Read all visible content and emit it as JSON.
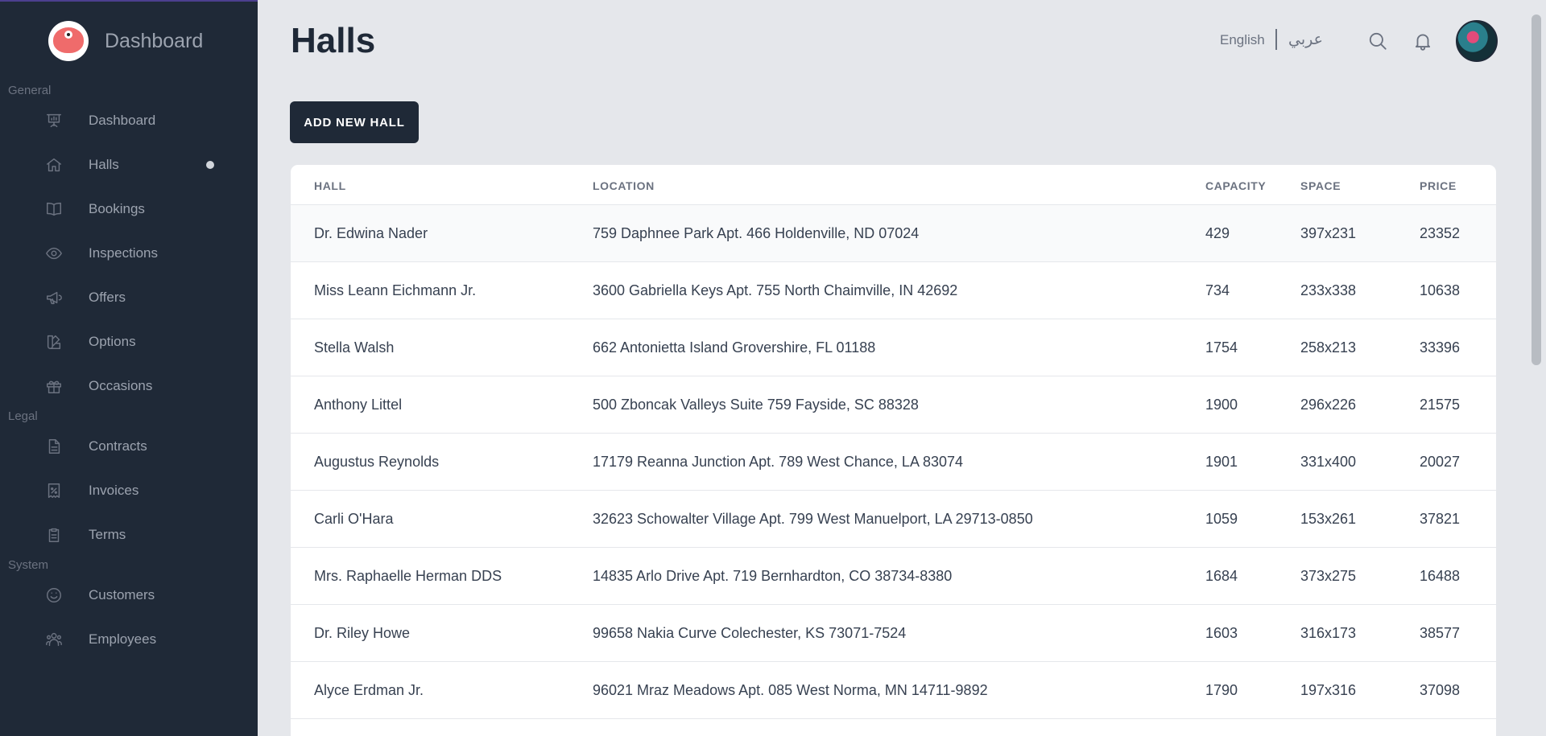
{
  "brand": {
    "title": "Dashboard"
  },
  "sidebar": {
    "sections": [
      {
        "label": "General",
        "items": [
          {
            "label": "Dashboard",
            "icon": "presentation-icon"
          },
          {
            "label": "Halls",
            "icon": "home-icon",
            "active": true
          },
          {
            "label": "Bookings",
            "icon": "book-icon"
          },
          {
            "label": "Inspections",
            "icon": "eye-icon"
          },
          {
            "label": "Offers",
            "icon": "megaphone-icon"
          },
          {
            "label": "Options",
            "icon": "swatch-icon"
          },
          {
            "label": "Occasions",
            "icon": "gift-icon"
          }
        ]
      },
      {
        "label": "Legal",
        "items": [
          {
            "label": "Contracts",
            "icon": "document-icon"
          },
          {
            "label": "Invoices",
            "icon": "receipt-icon"
          },
          {
            "label": "Terms",
            "icon": "clipboard-icon"
          }
        ]
      },
      {
        "label": "System",
        "items": [
          {
            "label": "Customers",
            "icon": "smile-icon"
          },
          {
            "label": "Employees",
            "icon": "users-icon"
          }
        ]
      }
    ]
  },
  "header": {
    "title": "Halls",
    "lang_en": "English",
    "lang_ar": "عربي"
  },
  "actions": {
    "add_label": "ADD NEW HALL"
  },
  "table": {
    "headers": {
      "hall": "HALL",
      "location": "LOCATION",
      "capacity": "CAPACITY",
      "space": "SPACE",
      "price": "PRICE"
    },
    "rows": [
      {
        "hall": "Dr. Edwina Nader",
        "location": "759 Daphnee Park Apt. 466 Holdenville, ND 07024",
        "capacity": "429",
        "space": "397x231",
        "price": "23352"
      },
      {
        "hall": "Miss Leann Eichmann Jr.",
        "location": "3600 Gabriella Keys Apt. 755 North Chaimville, IN 42692",
        "capacity": "734",
        "space": "233x338",
        "price": "10638"
      },
      {
        "hall": "Stella Walsh",
        "location": "662 Antonietta Island Grovershire, FL 01188",
        "capacity": "1754",
        "space": "258x213",
        "price": "33396"
      },
      {
        "hall": "Anthony Littel",
        "location": "500 Zboncak Valleys Suite 759 Fayside, SC 88328",
        "capacity": "1900",
        "space": "296x226",
        "price": "21575"
      },
      {
        "hall": "Augustus Reynolds",
        "location": "17179 Reanna Junction Apt. 789 West Chance, LA 83074",
        "capacity": "1901",
        "space": "331x400",
        "price": "20027"
      },
      {
        "hall": "Carli O'Hara",
        "location": "32623 Schowalter Village Apt. 799 West Manuelport, LA 29713-0850",
        "capacity": "1059",
        "space": "153x261",
        "price": "37821"
      },
      {
        "hall": "Mrs. Raphaelle Herman DDS",
        "location": "14835 Arlo Drive Apt. 719 Bernhardton, CO 38734-8380",
        "capacity": "1684",
        "space": "373x275",
        "price": "16488"
      },
      {
        "hall": "Dr. Riley Howe",
        "location": "99658 Nakia Curve Colechester, KS 73071-7524",
        "capacity": "1603",
        "space": "316x173",
        "price": "38577"
      },
      {
        "hall": "Alyce Erdman Jr.",
        "location": "96021 Mraz Meadows Apt. 085 West Norma, MN 14711-9892",
        "capacity": "1790",
        "space": "197x316",
        "price": "37098"
      }
    ]
  }
}
